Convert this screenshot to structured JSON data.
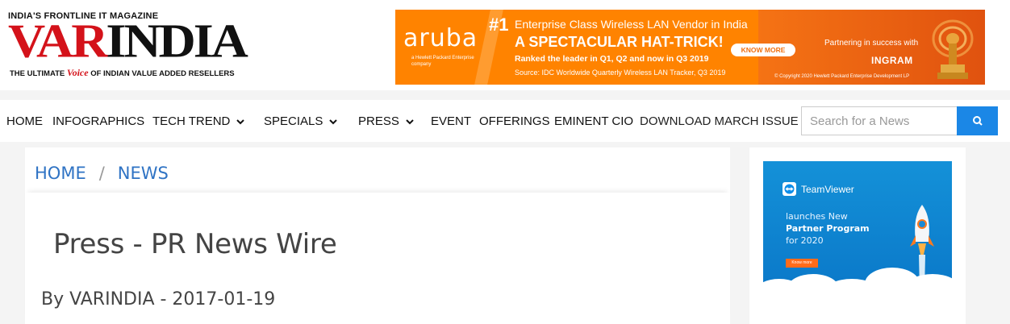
{
  "logo": {
    "tagline": "INDIA'S FRONTLINE IT MAGAZINE",
    "word_var": "VAR",
    "word_india": "INDIA",
    "sub_pre": "THE ULTIMATE ",
    "sub_voice": "Voice",
    "sub_post": " OF INDIAN VALUE ADDED RESELLERS"
  },
  "top_ad": {
    "brand": "aruba",
    "brand_sub": "a Hewlett Packard Enterprise company",
    "rank": "#1",
    "line1": "Enterprise Class Wireless LAN Vendor in India",
    "line2": "A SPECTACULAR HAT-TRICK!",
    "line3": "Ranked the leader in Q1, Q2 and now in Q3 2019",
    "line4": "Source: IDC Worldwide Quarterly Wireless LAN Tracker, Q3 2019",
    "button": "KNOW MORE",
    "partner": "Partnering in success with",
    "partner_name": "INGRAM",
    "copyright": "© Copyright 2020 Hewlett Packard Enterprise Development LP",
    "accent_color": "#ff8300"
  },
  "nav": {
    "items": [
      {
        "label": "HOME"
      },
      {
        "label": "INFOGRAPHICS"
      },
      {
        "label": "TECH TREND"
      },
      {
        "label": "SPECIALS"
      },
      {
        "label": "PRESS"
      },
      {
        "label": "EVENT"
      },
      {
        "label": "OFFERINGS"
      },
      {
        "label": "EMINENT CIO"
      },
      {
        "label": "DOWNLOAD MARCH ISSUE"
      }
    ],
    "search_placeholder": "Search for a News",
    "search_button_color": "#1b87e6"
  },
  "breadcrumb": {
    "home": "HOME",
    "separator": "/",
    "current": "NEWS",
    "link_color": "#2f73c4"
  },
  "article": {
    "title": "Press - PR News Wire",
    "byline": "By VARINDIA - 2017-01-19"
  },
  "side_ad": {
    "brand": "TeamViewer",
    "line1": "launches New",
    "line2": "Partner Program",
    "line3": "for 2020",
    "button": "Know more"
  }
}
